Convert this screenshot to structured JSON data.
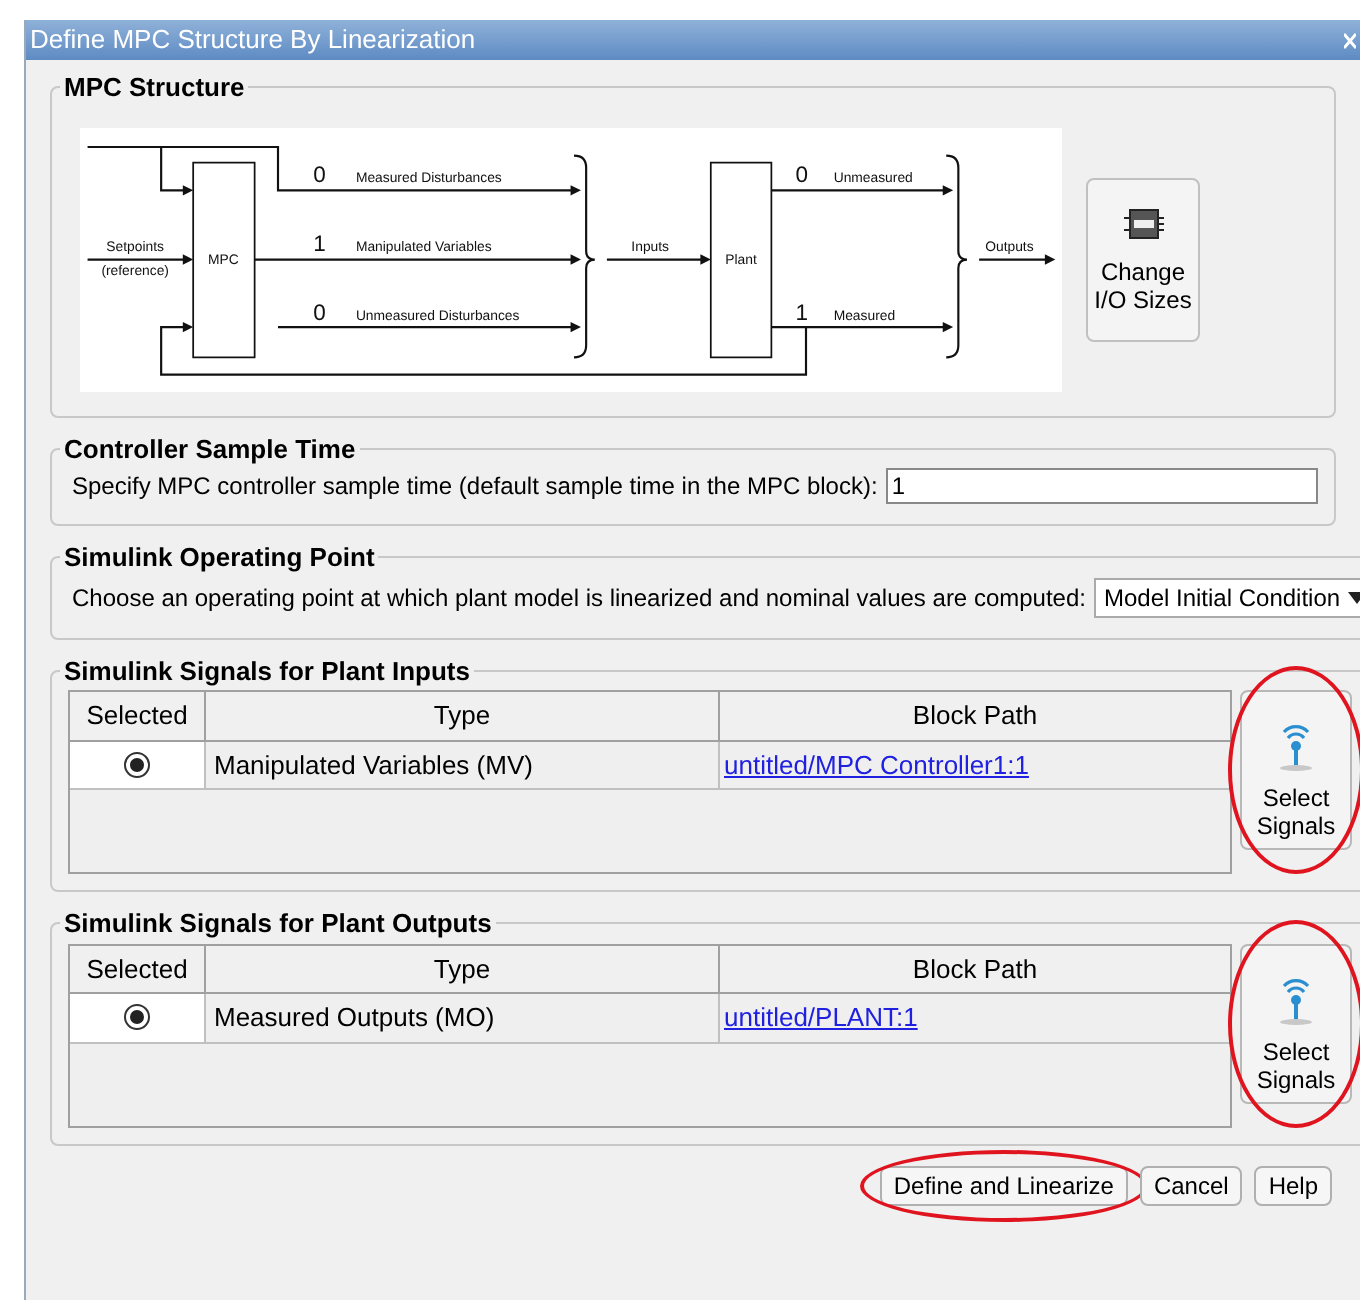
{
  "window": {
    "title": "Define MPC Structure By Linearization"
  },
  "structure": {
    "title": "MPC Structure",
    "diagram": {
      "setpoints": "Setpoints",
      "reference": "(reference)",
      "mpc": "MPC",
      "plant": "Plant",
      "inputs": "Inputs",
      "outputs": "Outputs",
      "signals": [
        {
          "count": "0",
          "label": "Measured Disturbances"
        },
        {
          "count": "1",
          "label": "Manipulated Variables"
        },
        {
          "count": "0",
          "label": "Unmeasured Disturbances"
        },
        {
          "count": "0",
          "label": "Unmeasured"
        },
        {
          "count": "1",
          "label": "Measured"
        }
      ]
    },
    "button": "Change I/O Sizes"
  },
  "sample_time": {
    "title": "Controller Sample Time",
    "label": "Specify MPC controller sample time (default sample time in the MPC block):",
    "value": "1"
  },
  "operating_point": {
    "title": "Simulink Operating Point",
    "label": "Choose an operating point at which plant model is linearized and nominal values are computed:",
    "value": "Model Initial Condition"
  },
  "signal_groups": [
    {
      "title": "Simulink Signals for Plant Inputs",
      "columns": [
        "Selected",
        "Type",
        "Block Path"
      ],
      "rows": [
        {
          "selected": true,
          "type": "Manipulated Variables (MV)",
          "path": "untitled/MPC Controller1:1"
        }
      ],
      "button": "Select Signals",
      "highlighted": true
    },
    {
      "title": "Simulink Signals for Plant Outputs",
      "columns": [
        "Selected",
        "Type",
        "Block Path"
      ],
      "rows": [
        {
          "selected": true,
          "type": "Measured Outputs (MO)",
          "path": "untitled/PLANT:1"
        }
      ],
      "button": "Select Signals",
      "highlighted": true
    }
  ],
  "buttons": [
    {
      "label": "Define and Linearize",
      "highlighted": true
    },
    {
      "label": "Cancel",
      "highlighted": false
    },
    {
      "label": "Help",
      "highlighted": false
    }
  ]
}
